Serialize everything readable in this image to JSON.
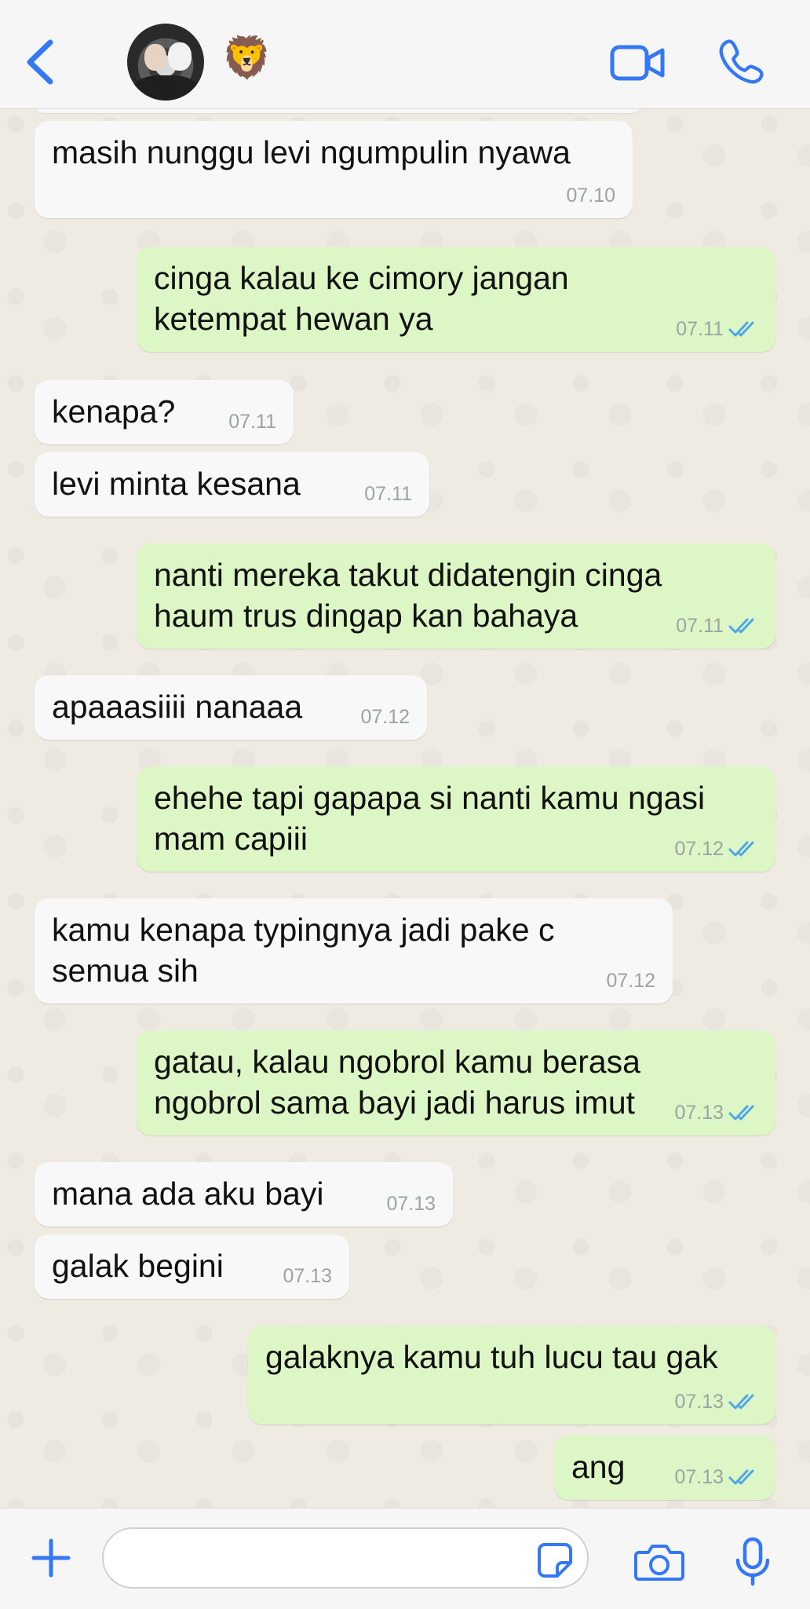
{
  "header": {
    "contact_name": "🦁",
    "icons": {
      "back": "chevron-left-icon",
      "video": "video-camera-icon",
      "call": "phone-icon"
    },
    "accent_color": "#3478f6"
  },
  "messages": [
    {
      "dir": "in",
      "lines": [
        "masih nunggu levi ngumpulin nyawa"
      ],
      "time": "07.10"
    },
    {
      "dir": "out",
      "lines": [
        "cinga kalau ke cimory jangan",
        "ketempat hewan ya"
      ],
      "time": "07.11"
    },
    {
      "dir": "in",
      "lines": [
        "kenapa?"
      ],
      "time": "07.11"
    },
    {
      "dir": "in",
      "lines": [
        "levi minta kesana"
      ],
      "time": "07.11"
    },
    {
      "dir": "out",
      "lines": [
        "nanti mereka takut didatengin cinga",
        "haum trus dingap kan bahaya"
      ],
      "time": "07.11"
    },
    {
      "dir": "in",
      "lines": [
        "apaaasiiii nanaaa"
      ],
      "time": "07.12"
    },
    {
      "dir": "out",
      "lines": [
        "ehehe tapi gapapa si nanti kamu ngasi",
        "mam capiii"
      ],
      "time": "07.12"
    },
    {
      "dir": "in",
      "lines": [
        "kamu kenapa typingnya jadi pake c",
        "semua sih"
      ],
      "time": "07.12"
    },
    {
      "dir": "out",
      "lines": [
        "gatau, kalau ngobrol kamu berasa",
        "ngobrol sama bayi jadi harus imut"
      ],
      "time": "07.13"
    },
    {
      "dir": "in",
      "lines": [
        "mana ada aku bayi"
      ],
      "time": "07.13"
    },
    {
      "dir": "in",
      "lines": [
        "galak begini"
      ],
      "time": "07.13"
    },
    {
      "dir": "out",
      "lines": [
        "galaknya kamu tuh lucu tau gak"
      ],
      "time": "07.13"
    },
    {
      "dir": "out",
      "lines": [
        "ang"
      ],
      "time": "07.13"
    }
  ],
  "composer": {
    "placeholder": "",
    "icons": {
      "attach": "plus-icon",
      "sticker": "sticker-icon",
      "camera": "camera-icon",
      "mic": "microphone-icon"
    }
  },
  "colors": {
    "incoming_bubble": "#f8f8f8",
    "outgoing_bubble": "#ddf6c5",
    "read_ticks": "#4fa6e8",
    "timestamp": "#9aa4a1"
  }
}
